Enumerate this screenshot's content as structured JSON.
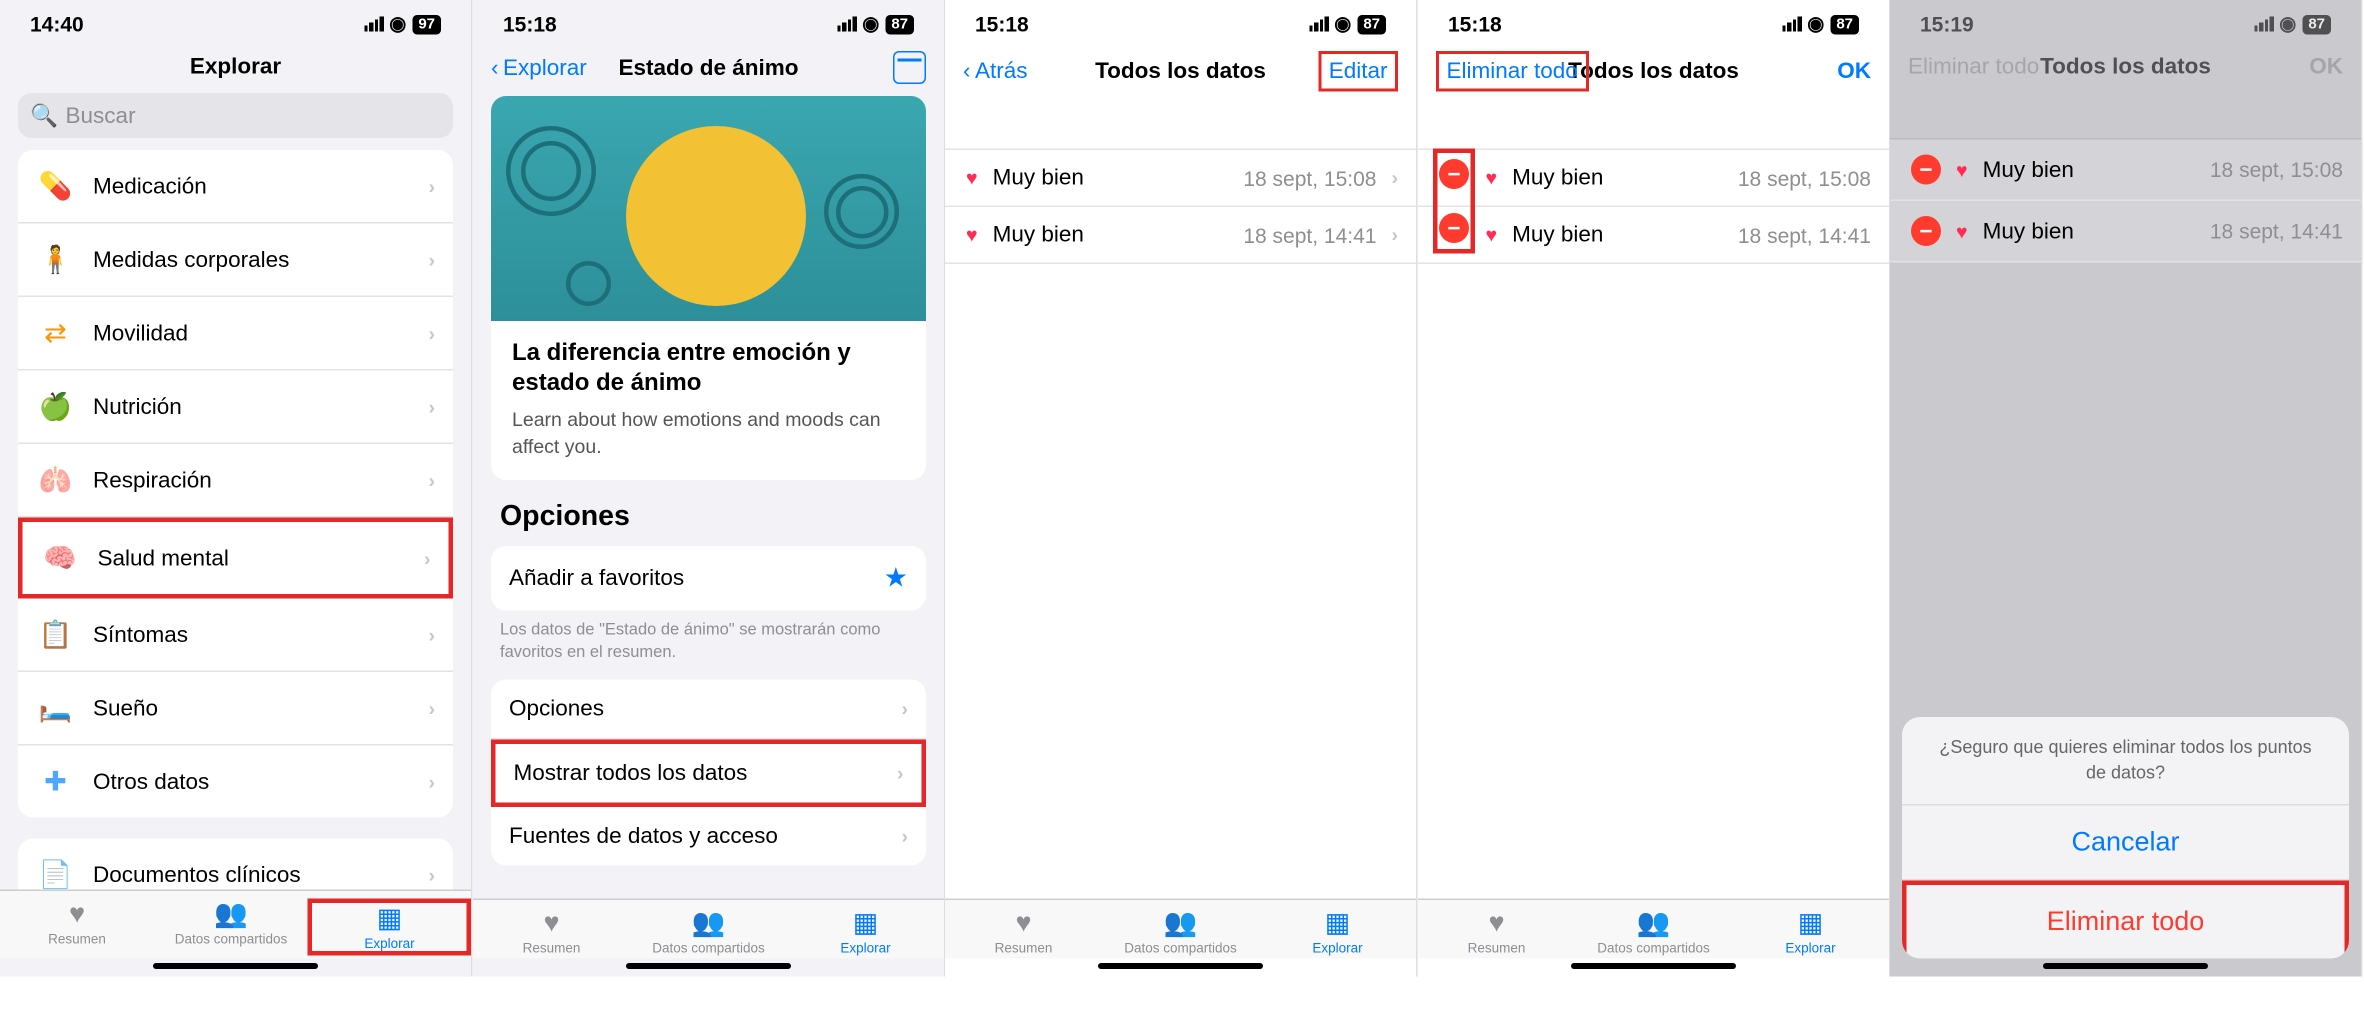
{
  "screens": {
    "s1": {
      "time": "14:40",
      "battery": "97",
      "title": "Explorar",
      "searchPlaceholder": "Buscar",
      "categories": [
        {
          "label": "Medicación"
        },
        {
          "label": "Medidas corporales"
        },
        {
          "label": "Movilidad"
        },
        {
          "label": "Nutrición"
        },
        {
          "label": "Respiración"
        },
        {
          "label": "Salud mental",
          "highlight": true
        },
        {
          "label": "Síntomas"
        },
        {
          "label": "Sueño"
        },
        {
          "label": "Otros datos"
        }
      ],
      "docsLabel": "Documentos clínicos"
    },
    "s2": {
      "time": "15:18",
      "battery": "87",
      "back": "Explorar",
      "title": "Estado de ánimo",
      "cardTitle": "La diferencia entre emoción y estado de ánimo",
      "cardText": "Learn about how emotions and moods can affect you.",
      "optionsHeader": "Opciones",
      "favLabel": "Añadir a favoritos",
      "favHelp": "Los datos de \"Estado de ánimo\" se mostrarán como favoritos en el resumen.",
      "rows": [
        {
          "label": "Opciones"
        },
        {
          "label": "Mostrar todos los datos",
          "highlight": true
        },
        {
          "label": "Fuentes de datos y acceso"
        }
      ]
    },
    "s3": {
      "time": "15:18",
      "battery": "87",
      "back": "Atrás",
      "title": "Todos los datos",
      "action": "Editar",
      "items": [
        {
          "label": "Muy bien",
          "date": "18 sept, 15:08"
        },
        {
          "label": "Muy bien",
          "date": "18 sept, 14:41"
        }
      ]
    },
    "s4": {
      "time": "15:18",
      "battery": "87",
      "leftAction": "Eliminar todo",
      "title": "Todos los datos",
      "rightAction": "OK",
      "items": [
        {
          "label": "Muy bien",
          "date": "18 sept, 15:08"
        },
        {
          "label": "Muy bien",
          "date": "18 sept, 14:41"
        }
      ]
    },
    "s5": {
      "time": "15:19",
      "battery": "87",
      "leftAction": "Eliminar todo",
      "title": "Todos los datos",
      "rightAction": "OK",
      "items": [
        {
          "label": "Muy bien",
          "date": "18 sept, 15:08"
        },
        {
          "label": "Muy bien",
          "date": "18 sept, 14:41"
        }
      ],
      "sheetMsg": "¿Seguro que quieres eliminar todos los puntos de datos?",
      "sheetCancel": "Cancelar",
      "sheetDelete": "Eliminar todo"
    }
  },
  "tabs": {
    "summary": "Resumen",
    "shared": "Datos compartidos",
    "explore": "Explorar"
  }
}
